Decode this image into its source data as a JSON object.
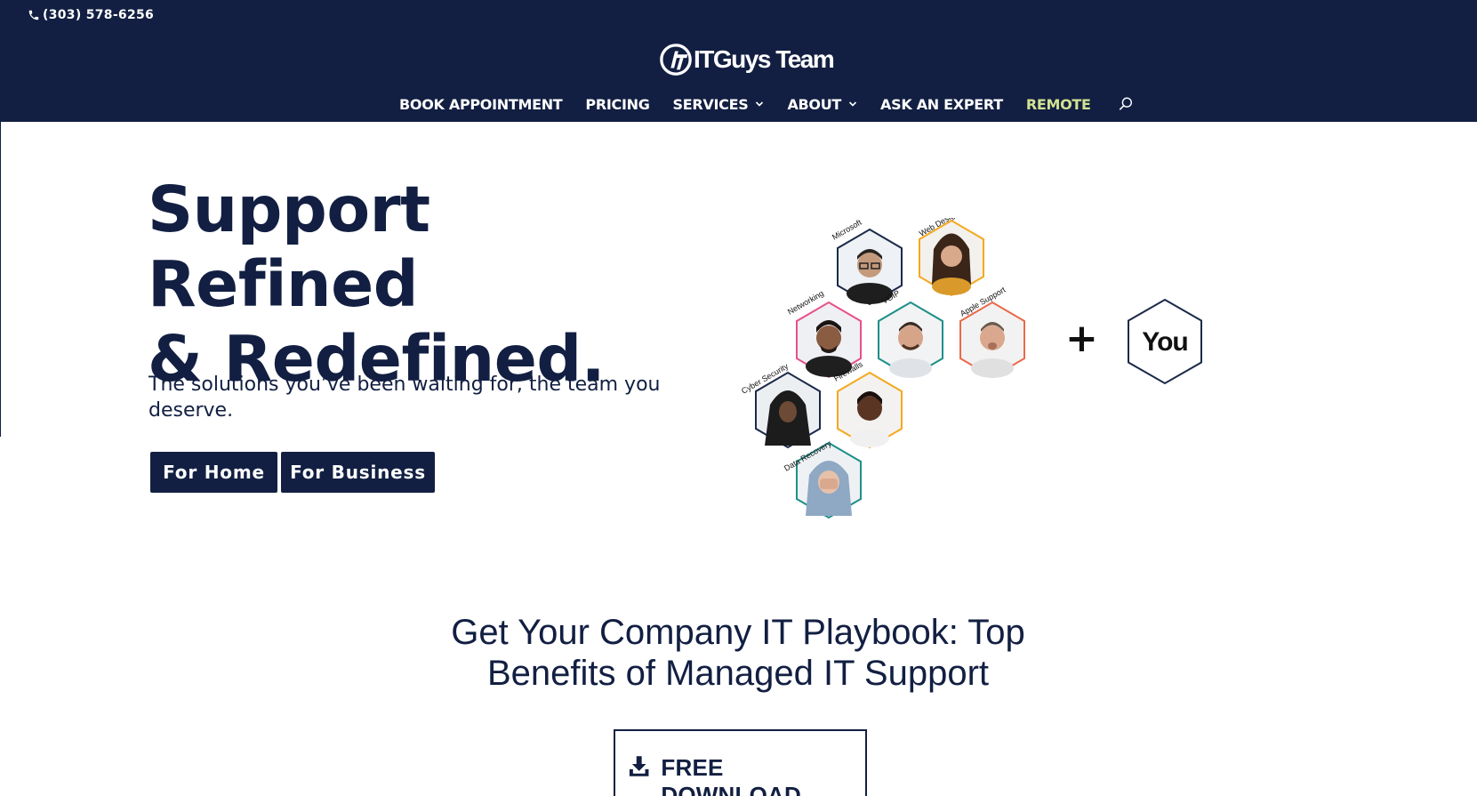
{
  "topbar": {
    "phone": "(303) 578-6256"
  },
  "brand": {
    "logo_text": "ITGuys Team"
  },
  "nav": {
    "items": [
      {
        "label": "BOOK APPOINTMENT"
      },
      {
        "label": "PRICING"
      },
      {
        "label": "SERVICES"
      },
      {
        "label": "ABOUT"
      },
      {
        "label": "ASK AN EXPERT"
      },
      {
        "label": "REMOTE"
      }
    ]
  },
  "hero": {
    "title_line1": "Support Refined",
    "title_line2": "& Redefined.",
    "subtitle": "The solutions you’ve been waiting for, the team you deserve.",
    "btn_home": "For Home",
    "btn_business": "For Business"
  },
  "graphic": {
    "hexes": [
      {
        "label": "Microsoft",
        "color": "#1b2a4a"
      },
      {
        "label": "Web Design",
        "color": "#f4a91e"
      },
      {
        "label": "Networking",
        "color": "#e8508a"
      },
      {
        "label": "VOIP",
        "color": "#1d8f88"
      },
      {
        "label": "Apple Support",
        "color": "#ea6a4a"
      },
      {
        "label": "Cyber Security",
        "color": "#1b2a4a"
      },
      {
        "label": "Firewalls",
        "color": "#f4a91e"
      },
      {
        "label": "Data Recovery",
        "color": "#1d8f88"
      }
    ],
    "plus": "+",
    "you": "You"
  },
  "playbook": {
    "title": "Get Your Company IT Playbook: Top Benefits of Managed IT Support",
    "download_label": "FREE DOWNLOAD"
  },
  "colors": {
    "navy": "#121f42",
    "remote": "#d3e290"
  }
}
